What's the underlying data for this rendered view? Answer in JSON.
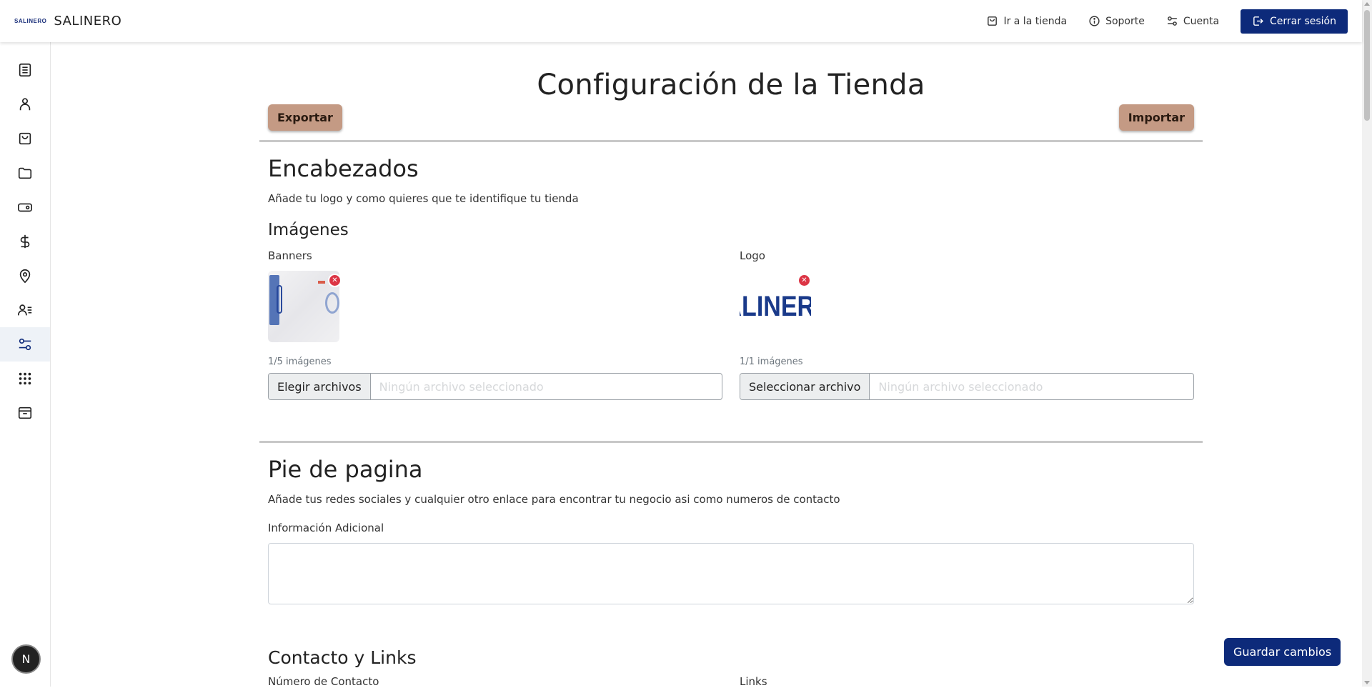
{
  "brand": {
    "logo_text": "SALINERO",
    "name": "SALINERO"
  },
  "topbar": {
    "store_link": "Ir a la tienda",
    "support_link": "Soporte",
    "account_link": "Cuenta",
    "logout": "Cerrar sesión"
  },
  "sidebar": {
    "items": [
      {
        "icon": "document-icon"
      },
      {
        "icon": "user-icon"
      },
      {
        "icon": "shopping-bag-icon"
      },
      {
        "icon": "folder-icon"
      },
      {
        "icon": "tag-icon"
      },
      {
        "icon": "dollar-icon"
      },
      {
        "icon": "location-pin-icon"
      },
      {
        "icon": "user-list-icon"
      },
      {
        "icon": "settings-sliders-icon",
        "active": true
      },
      {
        "icon": "apps-grid-icon"
      },
      {
        "icon": "archive-icon"
      }
    ],
    "avatar_initial": "N"
  },
  "page": {
    "title": "Configuración de la Tienda",
    "export": "Exportar",
    "import": "Importar"
  },
  "headers": {
    "title": "Encabezados",
    "description": "Añade tu logo y como quieres que te identifique tu tienda",
    "images_title": "Imágenes",
    "banners": {
      "label": "Banners",
      "count": "1/5 imágenes",
      "button": "Elegir archivos",
      "placeholder": "Ningún archivo seleccionado"
    },
    "logo": {
      "label": "Logo",
      "image_text": "ALINERO",
      "count": "1/1 imágenes",
      "button": "Seleccionar archivo",
      "placeholder": "Ningún archivo seleccionado"
    }
  },
  "footer": {
    "title": "Pie de pagina",
    "description": "Añade tus redes sociales y cualquier otro enlace para encontrar tu negocio asi como numeros de contacto",
    "additional_info_label": "Información Adicional",
    "contact_title": "Contacto y Links",
    "contact_number_label": "Número de Contacto",
    "links_label": "Links"
  },
  "save": "Guardar cambios",
  "colors": {
    "primary": "#0d2a7a",
    "brown": "#c49a84",
    "danger": "#dc3545"
  }
}
